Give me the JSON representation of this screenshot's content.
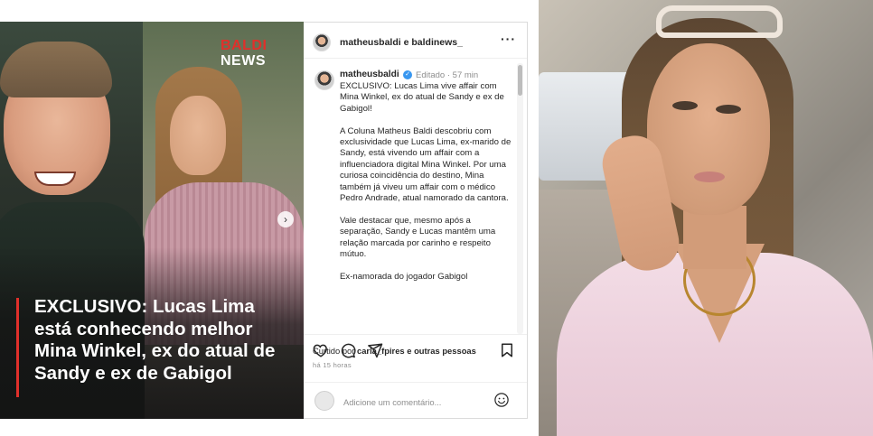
{
  "post_image": {
    "logo_line1": "BALDI",
    "logo_line2": "NEWS",
    "headline": "EXCLUSIVO: Lucas Lima está conhecendo melhor Mina Winkel, ex do atual de Sandy e ex de Gabigol",
    "accent_color": "#e0302b"
  },
  "instagram": {
    "header_user": "matheusbaldi e baldinews_",
    "caption_user": "matheusbaldi",
    "caption_meta": "Editado · 57 min",
    "caption_text": "EXCLUSIVO: Lucas Lima vive affair com Mina Winkel, ex do atual de Sandy e ex de Gabigol!\n\nA Coluna Matheus Baldi descobriu com exclusividade que Lucas Lima, ex-marido de Sandy, está vivendo um affair com a influenciadora digital Mina Winkel. Por uma curiosa coincidência do destino, Mina também já viveu um affair com o médico Pedro Andrade, atual namorado da cantora.\n\nVale destacar que, mesmo após a separação, Sandy e Lucas mantêm uma relação marcada por carinho e respeito mútuo.\n\nEx-namorada do jogador Gabigol",
    "likes_prefix": "Curtido por",
    "likes_user": "carla_fpires",
    "likes_suffix": "e outras pessoas",
    "time_ago": "há 15 horas",
    "comment_placeholder": "Adicione um comentário..."
  }
}
